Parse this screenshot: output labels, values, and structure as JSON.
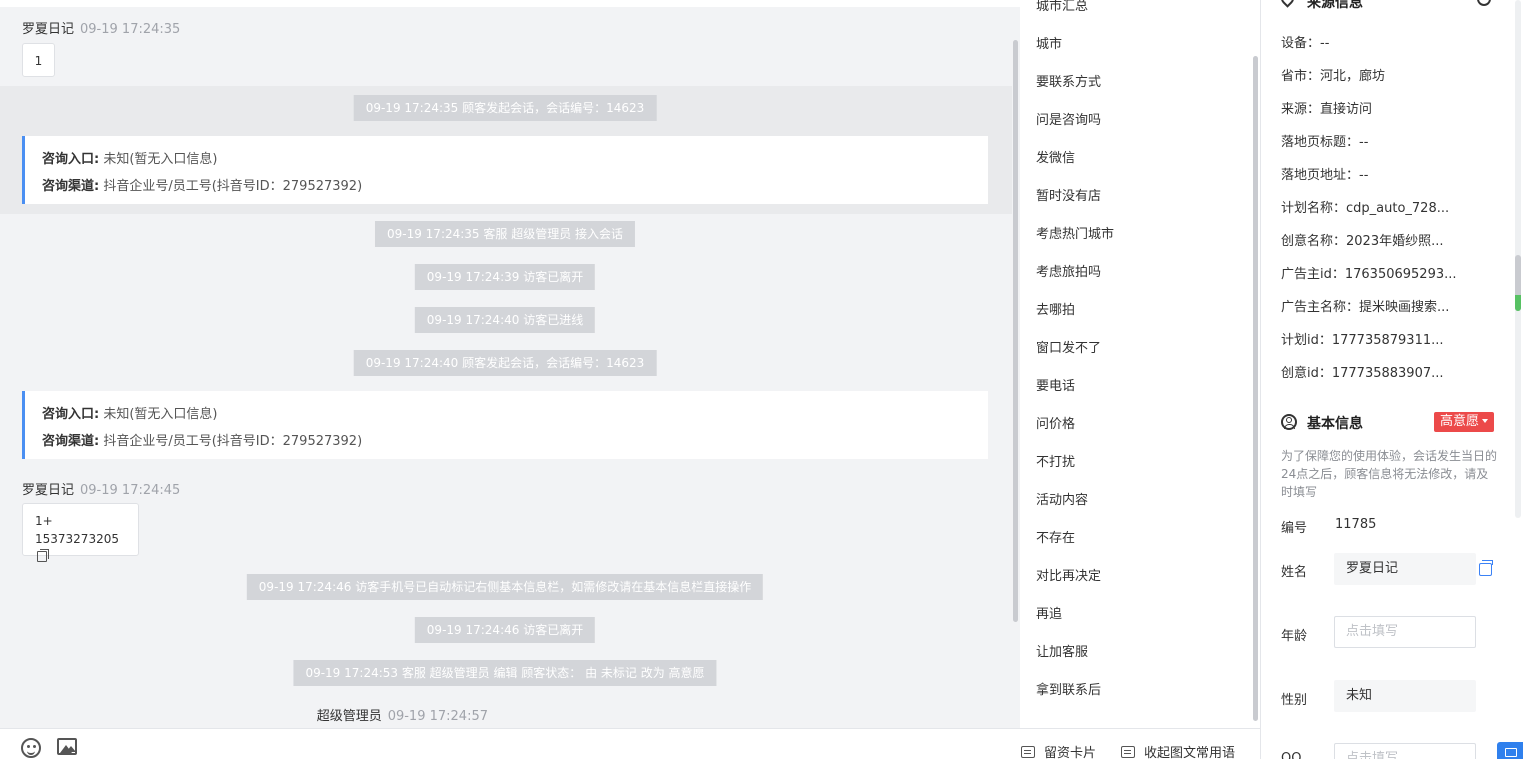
{
  "chat": {
    "messages": [
      {
        "sender": "罗夏日记",
        "time": "09-19 17:24:35",
        "text": "1"
      },
      {
        "sender": "罗夏日记",
        "time": "09-19 17:24:45",
        "text_line1": "1+",
        "text_line2": "15373273205"
      }
    ],
    "system": [
      "09-19 17:24:35 顾客发起会话，会话编号：14623",
      "09-19 17:24:35 客服 超级管理员 接入会话",
      "09-19 17:24:39 访客已离开",
      "09-19 17:24:40 访客已进线",
      "09-19 17:24:40 顾客发起会话，会话编号：14623",
      "09-19 17:24:46 访客手机号已自动标记右侧基本信息栏，如需修改请在基本信息栏直接操作",
      "09-19 17:24:46 访客已离开",
      "09-19 17:24:53 客服 超级管理员 编辑 顾客状态： 由 未标记 改为 高意愿"
    ],
    "info_cards": [
      {
        "entry_label": "咨询入口:",
        "entry_value": "未知(暂无入口信息)",
        "channel_label": "咨询渠道:",
        "channel_value": "抖音企业号/员工号(抖音号ID：279527392)"
      },
      {
        "entry_label": "咨询入口:",
        "entry_value": "未知(暂无入口信息)",
        "channel_label": "咨询渠道:",
        "channel_value": "抖音企业号/员工号(抖音号ID：279527392)"
      }
    ],
    "agent": {
      "name": "超级管理员",
      "time": "09-19 17:24:57"
    }
  },
  "toolbar": {
    "leave_card": "留资卡片",
    "collapse_phrases": "收起图文常用语"
  },
  "quick_replies": [
    "城市汇总",
    "城市",
    "要联系方式",
    "问是咨询吗",
    "发微信",
    "暂时没有店",
    "考虑热门城市",
    "考虑旅拍吗",
    "去哪拍",
    "窗口发不了",
    "要电话",
    "问价格",
    "不打扰",
    "活动内容",
    "不存在",
    "对比再决定",
    "再追",
    "让加客服",
    "拿到联系后"
  ],
  "source_info": {
    "title": "来源信息",
    "rows": [
      "设备：--",
      "省市：河北，廊坊",
      "来源：直接访问",
      "落地页标题：--",
      "落地页地址：--",
      "计划名称：cdp_auto_728...",
      "创意名称：2023年婚纱照...",
      "广告主id：176350695293...",
      "广告主名称：提米映画搜索...",
      "计划id：177735879311...",
      "创意id：177735883907..."
    ]
  },
  "basic_info": {
    "title": "基本信息",
    "badge": "高意愿",
    "notice": "为了保障您的使用体验，会话发生当日的24点之后，顾客信息将无法修改，请及时填写",
    "id_label": "编号",
    "id_value": "11785",
    "name_label": "姓名",
    "name_value": "罗夏日记",
    "age_label": "年龄",
    "age_placeholder": "点击填写",
    "gender_label": "性别",
    "gender_value": "未知",
    "qq_label": "QQ",
    "qq_placeholder": "点击填写"
  },
  "colors": {
    "accent_blue": "#4a8ff2",
    "badge_red": "#ec4a4a",
    "system_gray": "#d3d5d9"
  }
}
